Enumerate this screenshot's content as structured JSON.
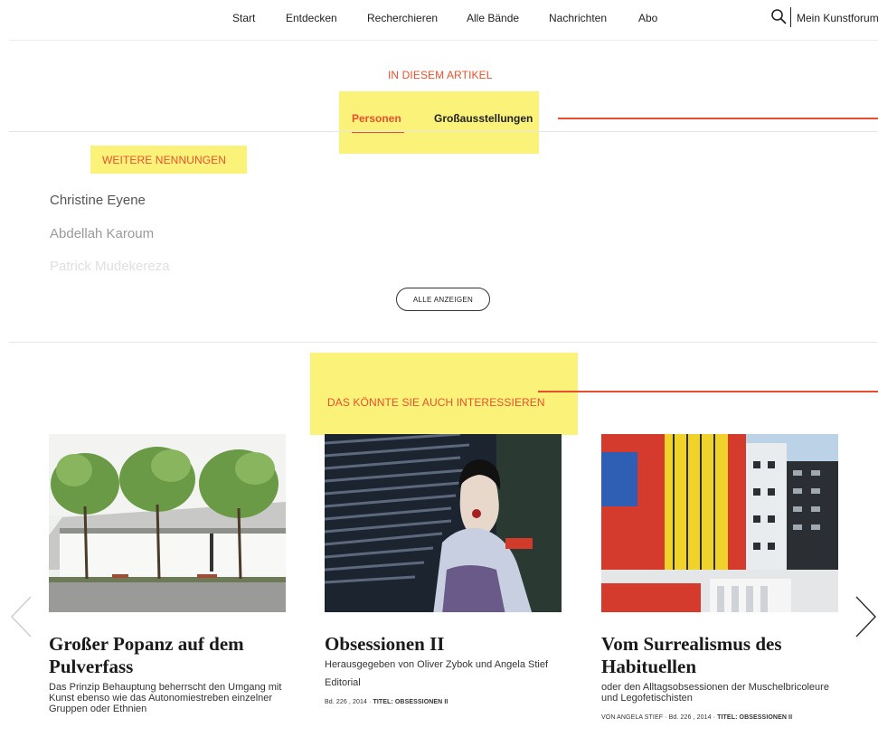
{
  "nav": {
    "items": [
      "Start",
      "Entdecken",
      "Recherchieren",
      "Alle Bände",
      "Nachrichten",
      "Abo"
    ],
    "search_icon": "search-icon",
    "account_label": "Mein Kunstforum"
  },
  "article_nav": {
    "heading": "IN DIESEM ARTIKEL",
    "tabs": [
      {
        "label": "Personen",
        "active": true
      },
      {
        "label": "Großausstellungen",
        "active": false
      }
    ]
  },
  "mentions": {
    "heading": "WEITERE NENNUNGEN",
    "names": [
      "Christine Eyene",
      "Abdellah Karoum",
      "Patrick Mudekereza"
    ],
    "show_all_label": "ALLE ANZEIGEN"
  },
  "related": {
    "heading": "DAS KÖNNTE SIE AUCH INTERESSIEREN",
    "cards": [
      {
        "title": "Großer Popanz auf dem Pulverfass",
        "subtitle": "Das Prinzip Behauptung beherrscht den Umgang mit Kunst ebenso wie das Autonomiestreben einzelner Gruppen oder Ethnien",
        "extra": "",
        "meta_prefix": "",
        "meta_issue": "",
        "meta_title": ""
      },
      {
        "title": "Obsessionen II",
        "subtitle": "Herausgegeben von Oliver Zybok und Angela Stief",
        "extra": "Editorial",
        "meta_prefix": "",
        "meta_issue": "Bd. 226 , 2014 · ",
        "meta_title": "TITEL: OBSESSIONEN II"
      },
      {
        "title": "Vom Surrealismus des Habituellen",
        "subtitle": "oder den Alltagsobsessionen der Muschelbricoleure und Legofetischisten",
        "extra": "",
        "meta_prefix": "VON ANGELA STIEF · ",
        "meta_issue": "Bd. 226 , 2014 · ",
        "meta_title": "TITEL: OBSESSIONEN II"
      }
    ]
  },
  "colors": {
    "accent": "#e8502d",
    "highlight": "#fbf27a",
    "text": "#222222"
  }
}
